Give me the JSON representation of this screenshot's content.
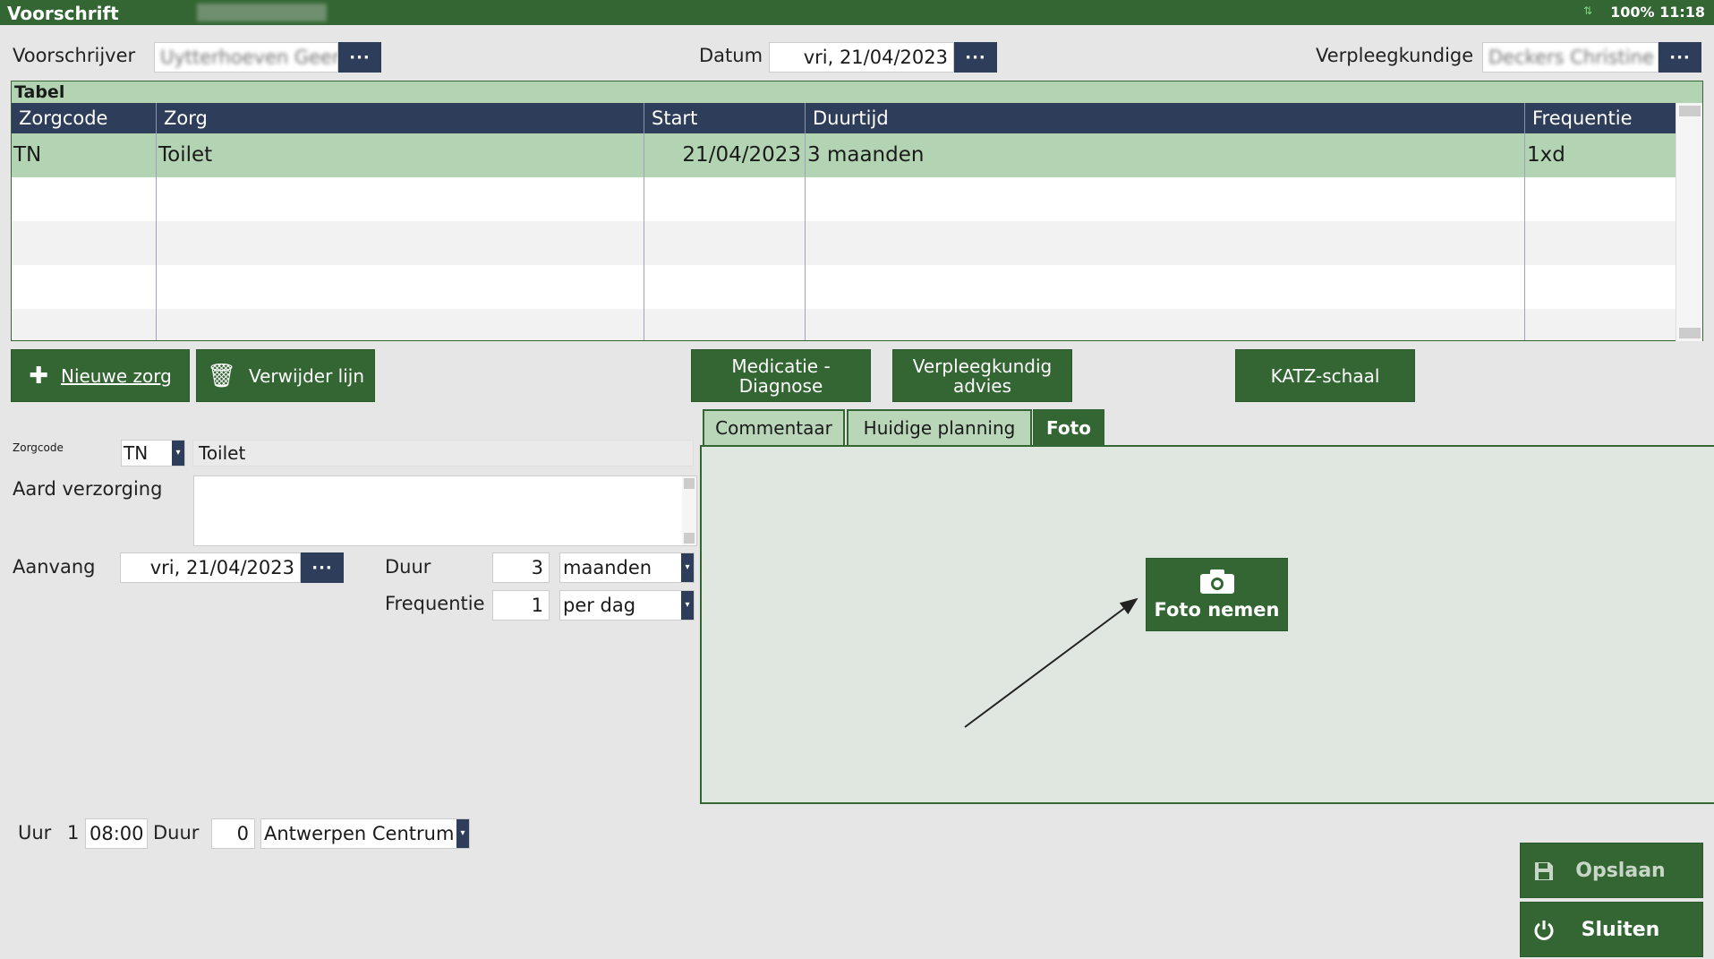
{
  "titlebar": {
    "title": "Voorschrift",
    "subtitle_blurred": "Bed Nr: [11]",
    "status": "100% 11:18"
  },
  "header": {
    "prescriber_label": "Voorschrijver",
    "prescriber_value": "Uytterhoeven Geer",
    "date_label": "Datum",
    "date_value": "vri, 21/04/2023",
    "nurse_label": "Verpleegkundige",
    "nurse_value": "Deckers Christine",
    "dots": "···"
  },
  "table": {
    "title": "Tabel",
    "columns": [
      "Zorgcode",
      "Zorg",
      "Start",
      "Duurtijd",
      "Frequentie"
    ],
    "rows": [
      {
        "code": "TN",
        "care": "Toilet",
        "start": "21/04/2023",
        "duration": "3 maanden",
        "frequency": "1xd"
      }
    ]
  },
  "buttons": {
    "new_care": "Nieuwe zorg",
    "delete_line": "Verwijder lijn",
    "medication": "Medicatie - Diagnose",
    "nurse_advice": "Verpleegkundig advies",
    "katz": "KATZ-schaal",
    "save": "Opslaan",
    "close": "Sluiten",
    "photo": "Foto nemen"
  },
  "tabs": [
    "Commentaar",
    "Huidige planning",
    "Foto"
  ],
  "form": {
    "zorgcode_label": "Zorgcode",
    "zorgcode_value": "TN",
    "zorg_name": "Toilet",
    "aard_label": "Aard verzorging",
    "aanvang_label": "Aanvang",
    "aanvang_value": "vri, 21/04/2023",
    "duur_label": "Duur",
    "duur_value": "3",
    "duur_unit": "maanden",
    "freq_label": "Frequentie",
    "freq_value": "1",
    "freq_unit": "per dag"
  },
  "bottom": {
    "uur_label": "Uur",
    "uur_index": "1",
    "uur_value": "08:00",
    "duur_label": "Duur",
    "duur_value": "0",
    "location": "Antwerpen Centrum"
  }
}
